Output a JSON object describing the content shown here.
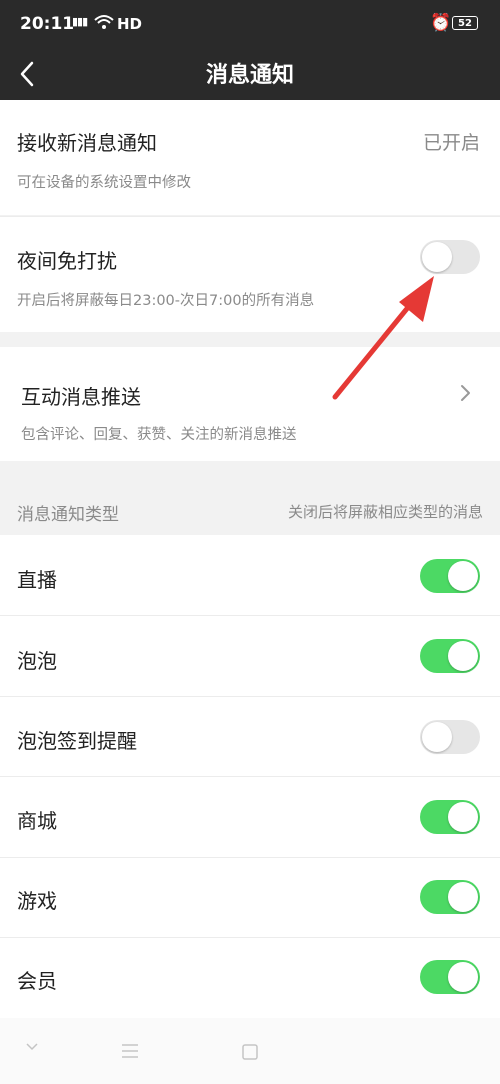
{
  "status_bar": {
    "time": "20:11",
    "signal": "4G",
    "network": "HD",
    "battery": "52",
    "icons": [
      "signal-icon",
      "wifi-icon",
      "alarm-icon",
      "battery-icon"
    ]
  },
  "header": {
    "title": "消息通知",
    "back_icon": "back-arrow-icon"
  },
  "notify_section": {
    "title": "接收新消息通知",
    "value": "已开启",
    "subtitle": "可在设备的系统设置中修改"
  },
  "night_section": {
    "title": "夜间免打扰",
    "subtitle": "开启后将屏蔽每日23:00-次日7:00的所有消息",
    "enabled": false
  },
  "interactive_section": {
    "title": "互动消息推送",
    "subtitle": "包含评论、回复、获赞、关注的新消息推送"
  },
  "types_header": {
    "left": "消息通知类型",
    "right": "关闭后将屏蔽相应类型的消息"
  },
  "types": [
    {
      "label": "直播",
      "enabled": true
    },
    {
      "label": "泡泡",
      "enabled": true
    },
    {
      "label": "泡泡签到提醒",
      "enabled": false
    },
    {
      "label": "商城",
      "enabled": true
    },
    {
      "label": "游戏",
      "enabled": true
    },
    {
      "label": "会员",
      "enabled": true
    }
  ],
  "colors": {
    "header_bg": "#2a2a2a",
    "toggle_on": "#4cd964",
    "toggle_off": "#e6e6e6",
    "annotation_arrow": "#e53935"
  },
  "nav_bar": {
    "icons": [
      "nav-back-icon",
      "nav-menu-icon",
      "nav-home-icon"
    ]
  }
}
